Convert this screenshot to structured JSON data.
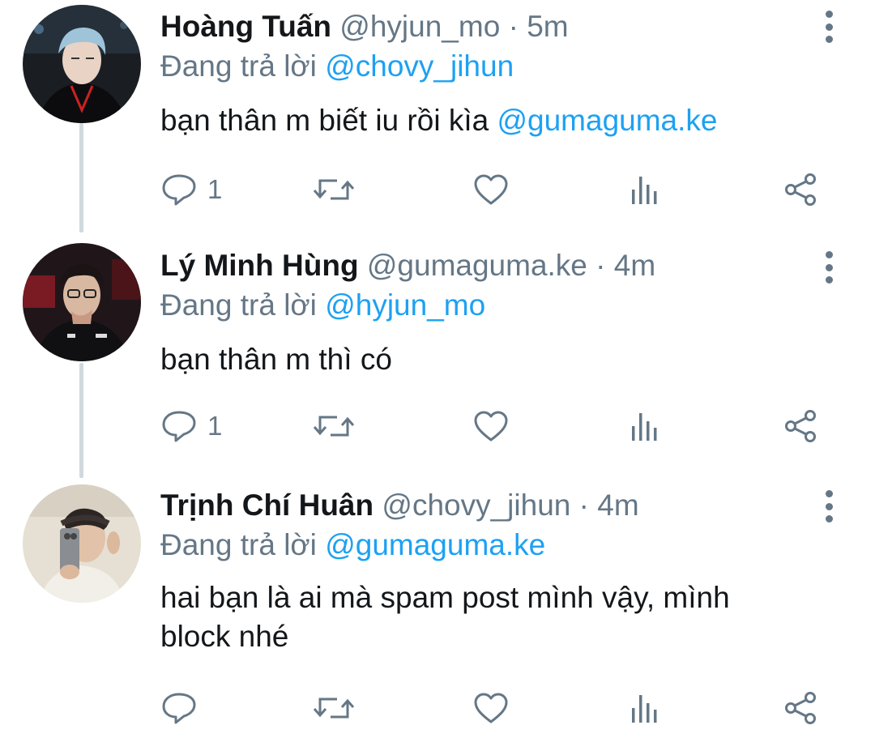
{
  "reply_prefix": "Đang trả lời",
  "tweets": [
    {
      "name": "Hoàng Tuấn",
      "handle": "@hyjun_mo",
      "dot": "·",
      "time": "5m",
      "reply_to": "@chovy_jihun",
      "text_plain": "bạn thân m biết iu rồi kìa ",
      "text_mention": "@gumaguma.ke",
      "reply_count": "1"
    },
    {
      "name": "Lý Minh Hùng",
      "handle": "@gumaguma.ke",
      "dot": "·",
      "time": "4m",
      "reply_to": "@hyjun_mo",
      "text_plain": "bạn thân m thì có",
      "text_mention": "",
      "reply_count": "1"
    },
    {
      "name": "Trịnh Chí Huân",
      "handle": "@chovy_jihun",
      "dot": "·",
      "time": "4m",
      "reply_to": "@gumaguma.ke",
      "text_line1": "hai bạn là ai mà spam post mình vậy, mình",
      "text_line2": "block nhé",
      "reply_count": ""
    }
  ],
  "colors": {
    "primary_text": "#14171a",
    "secondary_text": "#657786",
    "link": "#1da1f2",
    "thread_line": "#cfd9de"
  },
  "icons": [
    "reply-icon",
    "retweet-icon",
    "like-icon",
    "analytics-icon",
    "share-icon",
    "more-options-icon"
  ]
}
